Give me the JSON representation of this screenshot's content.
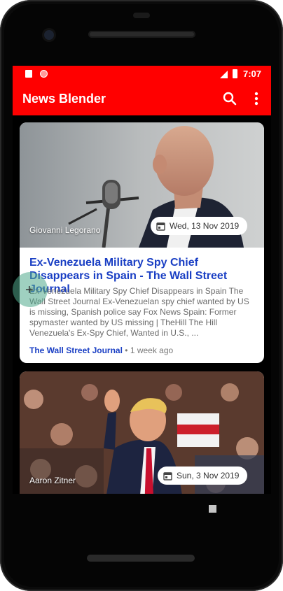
{
  "status_bar": {
    "time": "7:07"
  },
  "app_bar": {
    "title": "News Blender",
    "search_icon": "search-icon",
    "more_icon": "more-vert-icon"
  },
  "articles": [
    {
      "author": "Giovanni Legorano",
      "date": "Wed, 13 Nov 2019",
      "title": "Ex-Venezuela Military Spy Chief Disappears in Spain - The Wall Street Journal",
      "description": "Ex-Venezuela Military Spy Chief Disappears in Spain The Wall Street Journal Ex-Venezuelan spy chief wanted by US is missing, Spanish police say Fox News Spain: Former spymaster wanted by US missing | TheHill The Hill Venezuela's Ex-Spy Chief, Wanted in U.S., ...",
      "source": "The Wall Street Journal",
      "time_ago": "1 week ago"
    },
    {
      "author": "Aaron Zitner",
      "date": "Sun, 3 Nov 2019"
    }
  ],
  "colors": {
    "accent": "#ff0000",
    "link": "#1a3fc4"
  }
}
